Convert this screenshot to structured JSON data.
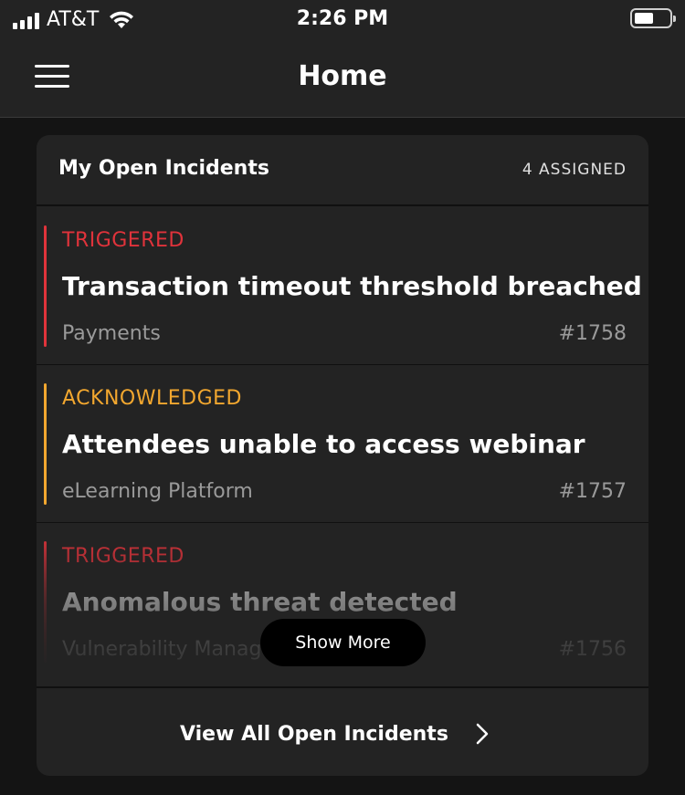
{
  "status_bar": {
    "carrier": "AT&T",
    "time": "2:26 PM",
    "icons": [
      "signal-icon",
      "wifi-icon",
      "battery-icon"
    ]
  },
  "nav": {
    "title": "Home",
    "menu_icon": "hamburger-icon"
  },
  "card": {
    "title": "My Open Incidents",
    "assigned_count": "4 ASSIGNED",
    "show_more_label": "Show More",
    "footer_label": "View All Open Incidents",
    "footer_icon": "chevron-right-icon"
  },
  "colors": {
    "triggered": "#e0333b",
    "acknowledged": "#f2a72f",
    "background": "#141414",
    "surface": "#232323"
  },
  "incidents": [
    {
      "status": "TRIGGERED",
      "title": "Transaction timeout threshold breached",
      "service": "Payments",
      "number": "#1758"
    },
    {
      "status": "ACKNOWLEDGED",
      "title": "Attendees unable to access webinar",
      "service": "eLearning Platform",
      "number": "#1757"
    },
    {
      "status": "TRIGGERED",
      "title": "Anomalous threat detected",
      "service": "Vulnerability Management",
      "number": "#1756"
    }
  ]
}
